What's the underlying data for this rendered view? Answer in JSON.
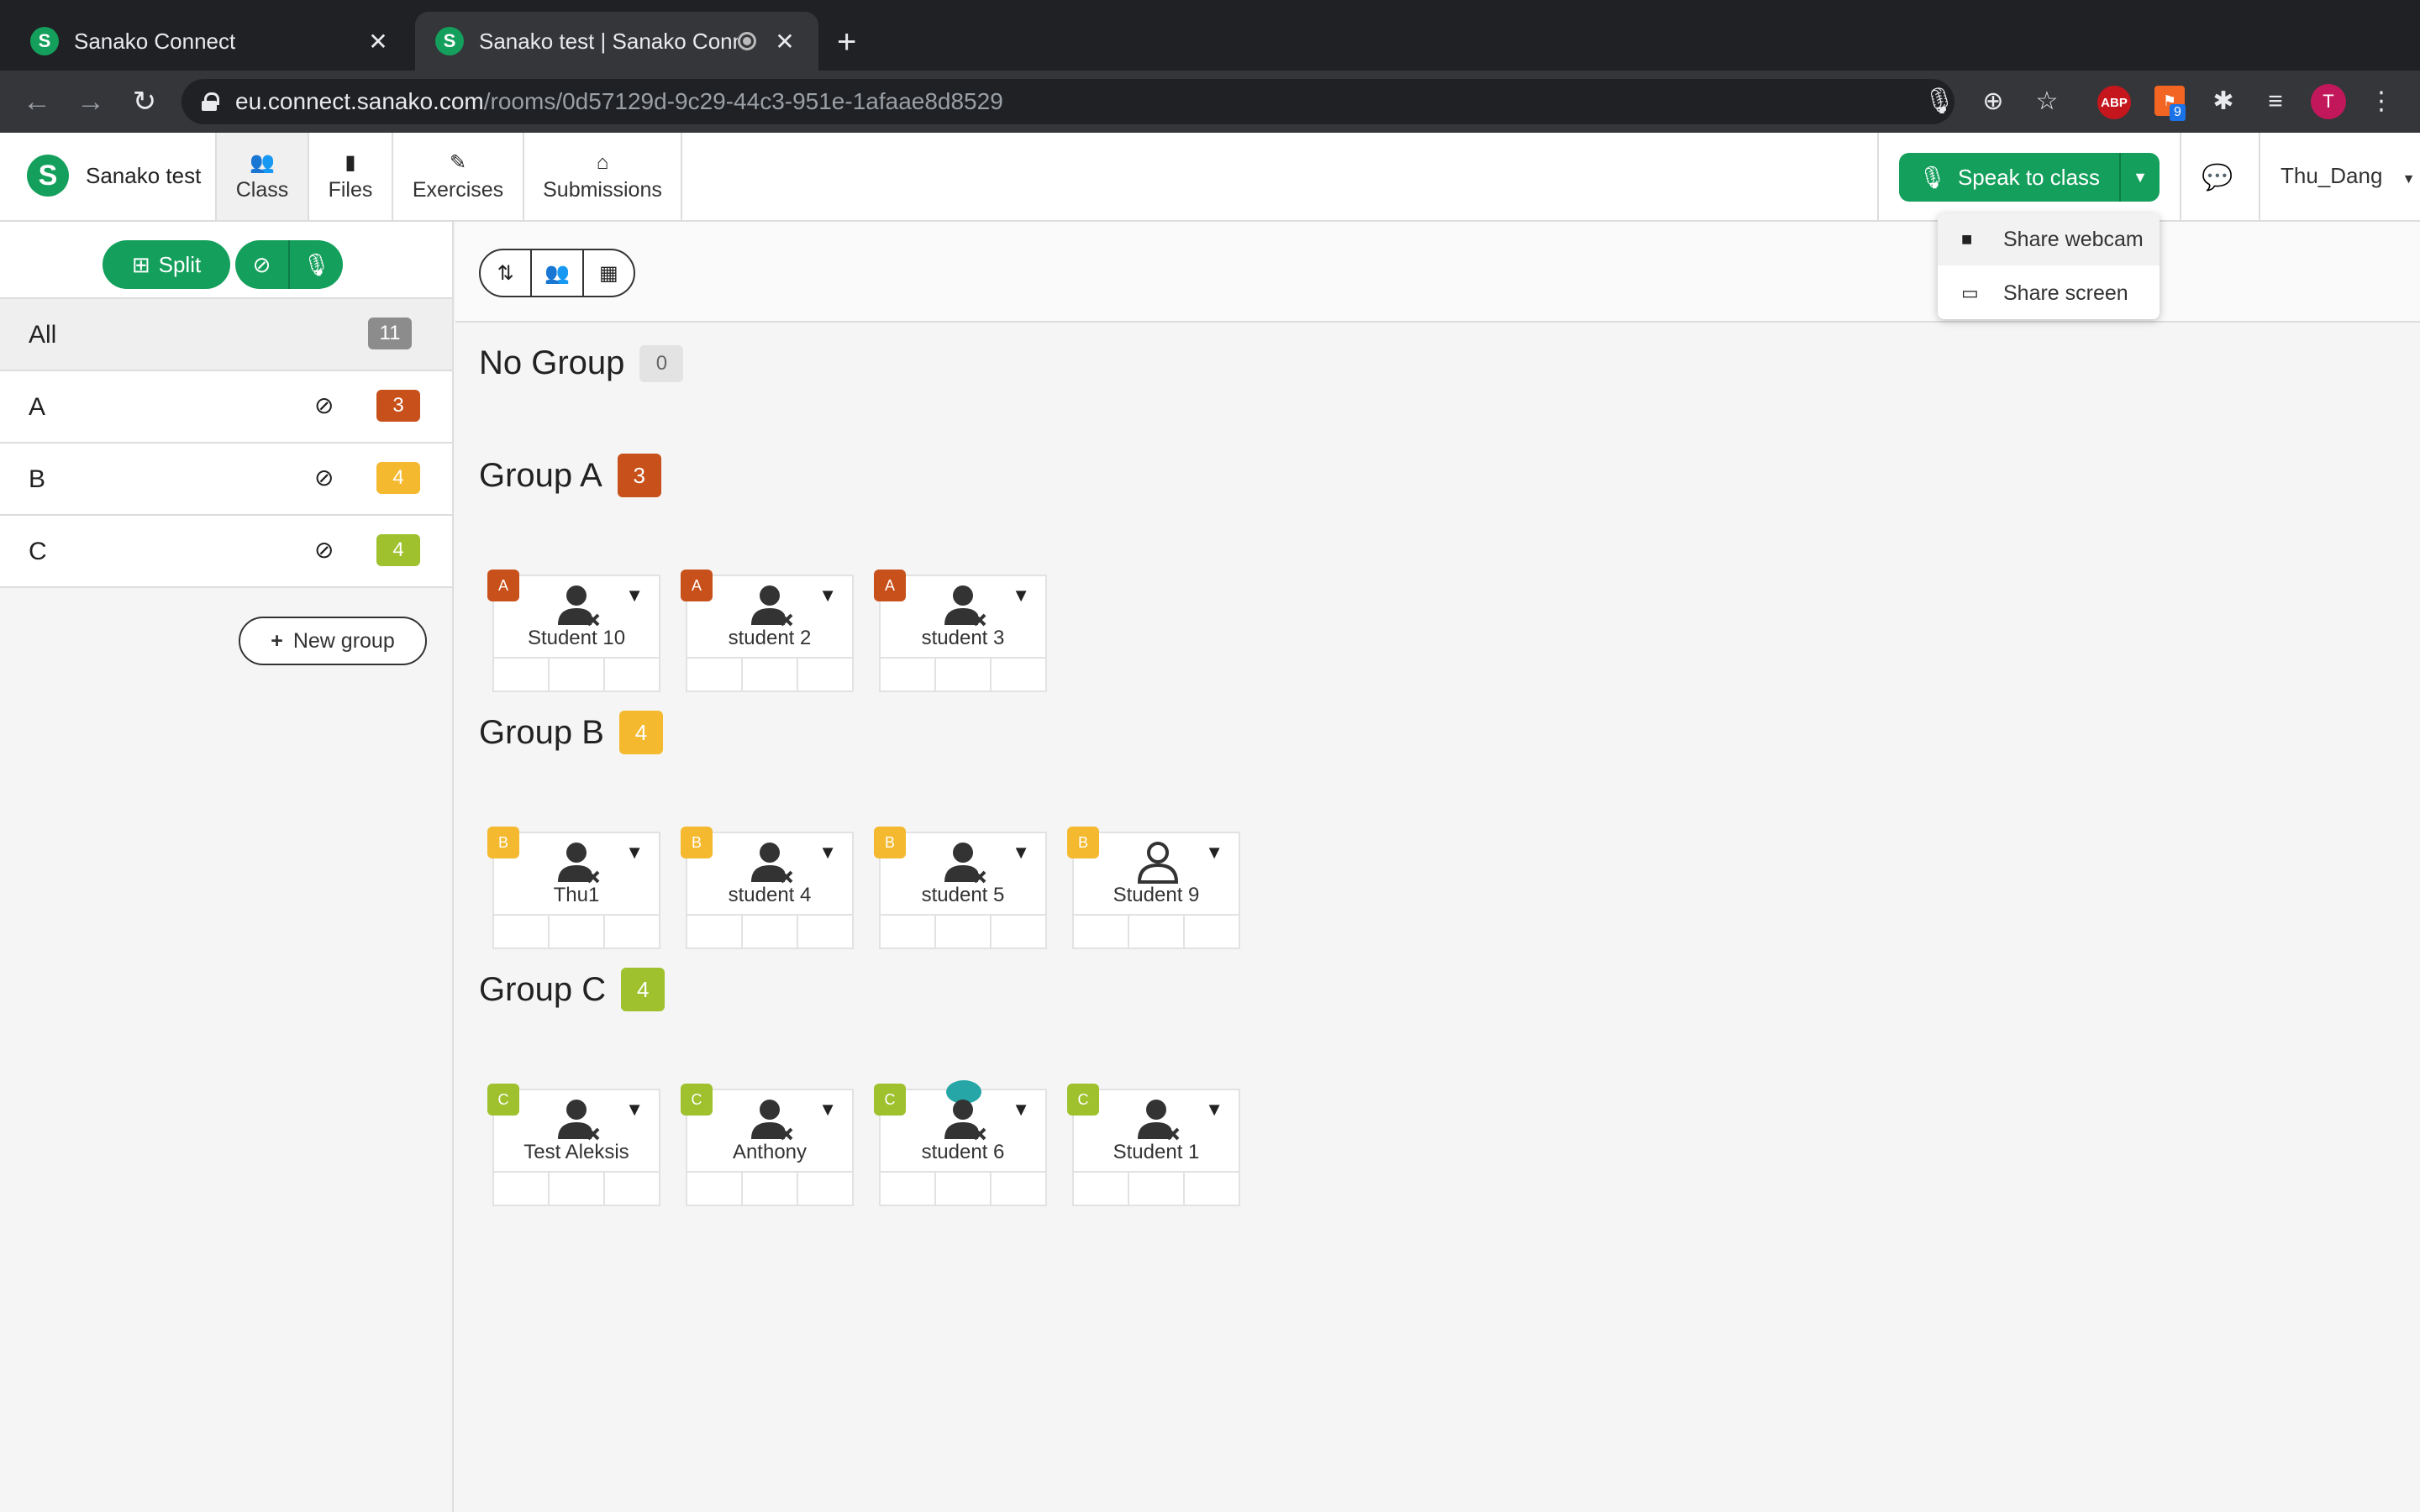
{
  "browser": {
    "tabs": [
      {
        "title": "Sanako Connect"
      },
      {
        "title": "Sanako test | Sanako Conn"
      }
    ],
    "url_host": "eu.connect.sanako.com",
    "url_path": "/rooms/0d57129d-9c29-44c3-951e-1afaae8d8529",
    "abp_label": "ABP",
    "ext_badge": "9",
    "profile_initial": "T",
    "favicon_letter": "S"
  },
  "header": {
    "brand": "Sanako test",
    "logo_letter": "S",
    "tabs": [
      {
        "label": "Class",
        "icon": "people-icon"
      },
      {
        "label": "Files",
        "icon": "file-icon"
      },
      {
        "label": "Exercises",
        "icon": "edit-icon"
      },
      {
        "label": "Submissions",
        "icon": "inbox-icon"
      }
    ],
    "speak_label": "Speak to class",
    "user": "Thu_Dang"
  },
  "dropdown": {
    "items": [
      {
        "label": "Share webcam",
        "icon": "video-camera-icon"
      },
      {
        "label": "Share screen",
        "icon": "monitor-icon"
      }
    ]
  },
  "sidebar": {
    "split_label": "Split",
    "groups": [
      {
        "name": "All",
        "count": "11",
        "color": "#8c8c8c"
      },
      {
        "name": "A",
        "count": "3",
        "color": "#c8501a"
      },
      {
        "name": "B",
        "count": "4",
        "color": "#f4b92e"
      },
      {
        "name": "C",
        "count": "4",
        "color": "#9ec12d"
      }
    ],
    "new_group_label": "New group"
  },
  "sections": [
    {
      "title": "No Group",
      "count": "0",
      "color": "#e3e3e3",
      "students": []
    },
    {
      "title": "Group A",
      "count": "3",
      "color": "#c8501a",
      "tag": "A",
      "students": [
        "Student 10",
        "student 2",
        "student 3"
      ]
    },
    {
      "title": "Group B",
      "count": "4",
      "color": "#f4b92e",
      "tag": "B",
      "students": [
        "Thu1",
        "student 4",
        "student 5",
        "Student 9"
      ]
    },
    {
      "title": "Group C",
      "count": "4",
      "color": "#9ec12d",
      "tag": "C",
      "students": [
        "Test Aleksis",
        "Anthony",
        "student 6",
        "Student 1"
      ]
    }
  ]
}
